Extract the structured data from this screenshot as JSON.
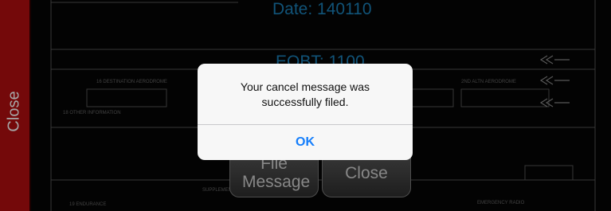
{
  "sidebar": {
    "close_label": "Close"
  },
  "form": {
    "date_label": "Date: 140110",
    "eobt_label": "EOBT: 1100"
  },
  "buttons": {
    "file_message_label": "File Message",
    "close_label": "Close"
  },
  "alert": {
    "message": "Your cancel message was successfully filed.",
    "ok_label": "OK"
  },
  "colors": {
    "sidebar": "#b30f10",
    "label_blue": "#1b80b8",
    "ios_blue": "#157efb"
  }
}
